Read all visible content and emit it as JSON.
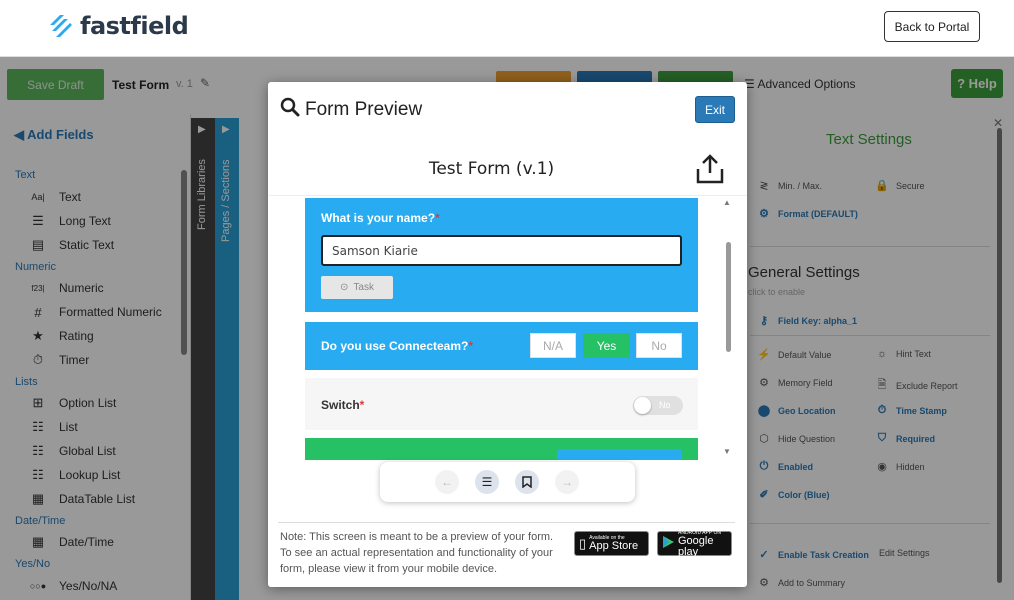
{
  "topbar": {
    "logo_text": "fastfield",
    "back_button": "Back to Portal"
  },
  "toolbar": {
    "save_draft": "Save Draft",
    "form_name": "Test Form",
    "version": "v. 1",
    "advanced_options": "Advanced Options",
    "help": "? Help"
  },
  "sidebar": {
    "title": "Add Fields",
    "categories": {
      "text": "Text",
      "numeric": "Numeric",
      "lists": "Lists",
      "datetime": "Date/Time",
      "yesno": "Yes/No"
    },
    "items": {
      "text": "Text",
      "long_text": "Long Text",
      "static_text": "Static Text",
      "numeric": "Numeric",
      "formatted_numeric": "Formatted Numeric",
      "rating": "Rating",
      "timer": "Timer",
      "option_list": "Option List",
      "list": "List",
      "global_list": "Global List",
      "lookup_list": "Lookup List",
      "datatable_list": "DataTable List",
      "date_time": "Date/Time",
      "yes_no_na": "Yes/No/NA"
    }
  },
  "vtabs": {
    "form_libraries": "Form Libraries",
    "pages_sections": "Pages / Sections"
  },
  "right_panel": {
    "title": "Text Settings",
    "min_max": "Min. / Max.",
    "secure": "Secure",
    "format": "Format (DEFAULT)",
    "general_title": "General Settings",
    "general_sub": "click to enable",
    "field_key": "Field Key: alpha_1",
    "default_value": "Default Value",
    "hint_text": "Hint Text",
    "memory_field": "Memory Field",
    "exclude_report": "Exclude Report",
    "geo_location": "Geo Location",
    "time_stamp": "Time Stamp",
    "hide_question": "Hide Question",
    "required": "Required",
    "enabled": "Enabled",
    "hidden": "Hidden",
    "color": "Color (Blue)",
    "enable_task": "Enable Task Creation",
    "edit_settings": "Edit Settings",
    "add_summary": "Add to Summary"
  },
  "modal": {
    "title": "Form Preview",
    "exit": "Exit",
    "form_title": "Test Form (v.1)",
    "q1": {
      "label": "What is your name?",
      "required": "*",
      "value": "Samson Kiarie",
      "task": "Task"
    },
    "q2": {
      "label": "Do you use Connecteam?",
      "required": "*",
      "options": [
        "N/A",
        "Yes",
        "No"
      ],
      "selected": "Yes"
    },
    "q3": {
      "label": "Switch",
      "required": "*",
      "toggle_text": "No"
    },
    "note": "Note: This screen is meant to be a preview of your form. To see an actual representation and functionality of your form, please view it from your mobile device.",
    "app_store": {
      "small": "Available on the",
      "big": "App Store"
    },
    "google_play": {
      "small": "ANDROID APP ON",
      "big": "Google play"
    }
  },
  "colors": {
    "accent_blue": "#29abf2",
    "green": "#27c165",
    "brand_blue": "#2a7ab8"
  }
}
